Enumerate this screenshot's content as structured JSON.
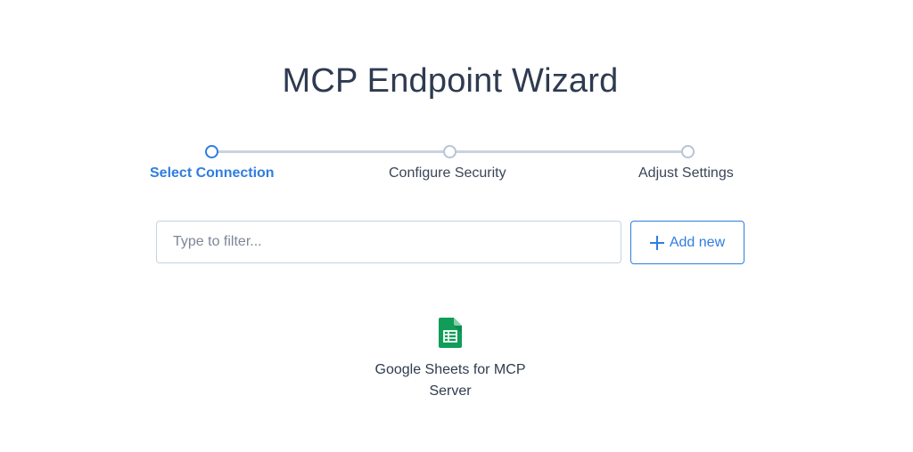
{
  "page": {
    "title": "MCP Endpoint Wizard"
  },
  "stepper": {
    "steps": [
      {
        "label": "Select Connection",
        "active": true
      },
      {
        "label": "Configure Security",
        "active": false
      },
      {
        "label": "Adjust Settings",
        "active": false
      }
    ]
  },
  "filter": {
    "placeholder": "Type to filter...",
    "value": ""
  },
  "toolbar": {
    "add_label": "Add new",
    "add_icon": "plus-icon"
  },
  "connections": [
    {
      "name": "Google Sheets for MCP Server",
      "icon": "google-sheets-icon"
    }
  ],
  "colors": {
    "accent": "#2f7de1",
    "sheets_green": "#0f9d58",
    "text": "#2e3b50"
  }
}
